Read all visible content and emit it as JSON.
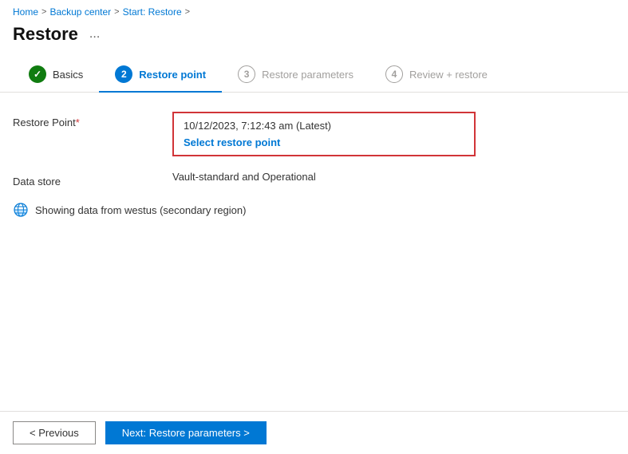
{
  "breadcrumb": {
    "home": "Home",
    "sep1": ">",
    "backup_center": "Backup center",
    "sep2": ">",
    "start_restore": "Start: Restore",
    "sep3": ">"
  },
  "page": {
    "title": "Restore",
    "ellipsis": "..."
  },
  "tabs": [
    {
      "id": "basics",
      "number": "✓",
      "label": "Basics",
      "state": "completed"
    },
    {
      "id": "restore-point",
      "number": "2",
      "label": "Restore point",
      "state": "active"
    },
    {
      "id": "restore-parameters",
      "number": "3",
      "label": "Restore parameters",
      "state": "inactive"
    },
    {
      "id": "review-restore",
      "number": "4",
      "label": "Review + restore",
      "state": "inactive"
    }
  ],
  "form": {
    "restore_point_label": "Restore Point",
    "restore_point_required": "*",
    "restore_point_value": "10/12/2023, 7:12:43 am (Latest)",
    "select_restore_point": "Select restore point",
    "data_store_label": "Data store",
    "data_store_value": "Vault-standard and Operational",
    "info_text": "Showing data from westus (secondary region)"
  },
  "footer": {
    "prev_label": "< Previous",
    "next_label": "Next: Restore parameters >"
  }
}
